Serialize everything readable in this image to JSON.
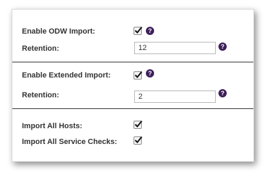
{
  "odw": {
    "enable_label": "Enable ODW Import:",
    "enable_checked": true,
    "retention_label": "Retention:",
    "retention_value": "12",
    "help": "?"
  },
  "extended": {
    "enable_label": "Enable Extended Import:",
    "enable_checked": true,
    "retention_label": "Retention:",
    "retention_value": "2",
    "help": "?"
  },
  "import": {
    "all_hosts_label": "Import All Hosts:",
    "all_hosts_checked": true,
    "all_service_checks_label": "Import All Service Checks:",
    "all_service_checks_checked": true
  },
  "colors": {
    "help_icon_bg": "#3d1f5a",
    "divider": "#333333"
  }
}
